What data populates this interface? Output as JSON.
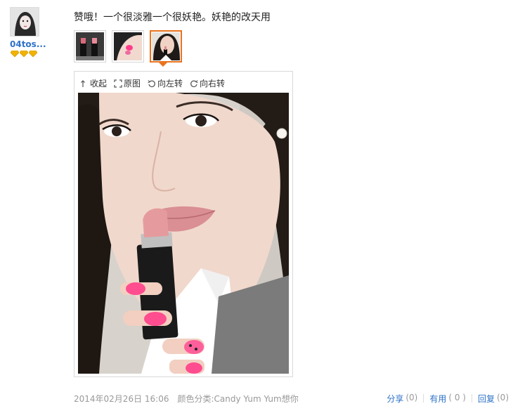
{
  "user": {
    "name": "04tos...",
    "badge_count": 3,
    "badge_color": "#f0b400"
  },
  "review": {
    "text": "赞哦！一个很淡雅一个很妖艳。妖艳的改天用"
  },
  "thumbnails": [
    {
      "icon": "lipsticks-photo-icon",
      "active": false
    },
    {
      "icon": "swatch-photo-icon",
      "active": false
    },
    {
      "icon": "selfie-photo-icon",
      "active": true
    }
  ],
  "viewer": {
    "collapse_label": "收起",
    "original_label": "原图",
    "rotate_left_label": "向左转",
    "rotate_right_label": "向右转"
  },
  "meta": {
    "date": "2014年02月26日 16:06",
    "variant": "颜色分类:Candy Yum Yum想你"
  },
  "actions": {
    "share_label": "分享",
    "share_count": "(0)",
    "useful_label": "有用",
    "useful_count": "( 0 )",
    "reply_label": "回复",
    "reply_count": "(0)"
  },
  "colors": {
    "link": "#2f72c7",
    "accent": "#e9731e",
    "muted": "#999999"
  }
}
